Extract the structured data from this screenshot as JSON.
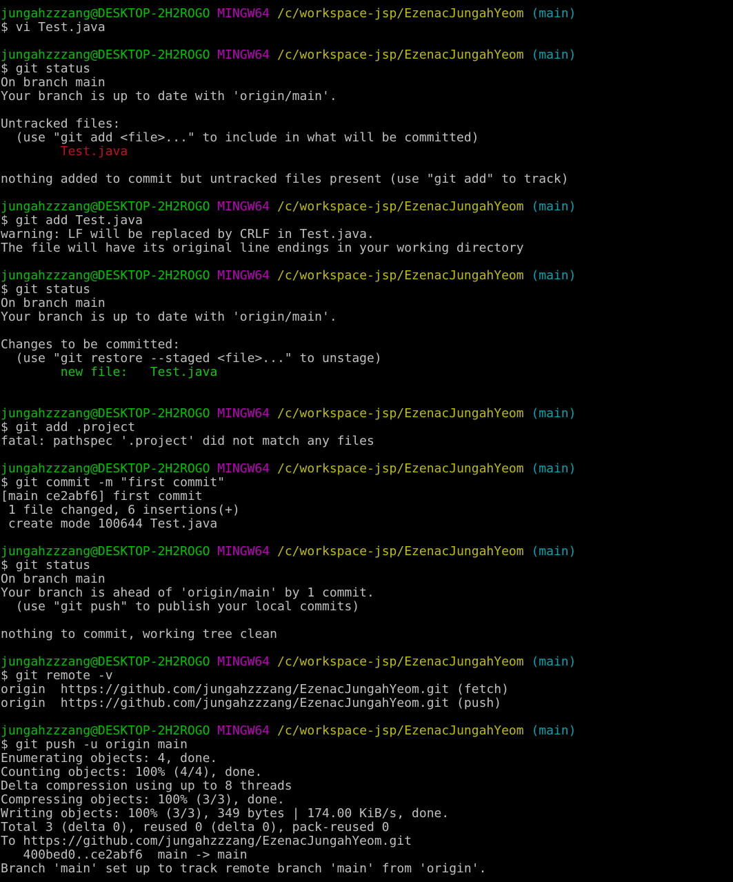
{
  "colors": {
    "background": "#000000",
    "default_text": "#c0c0c0",
    "user_host": "#00c400",
    "mingw": "#bf00bf",
    "path": "#bfbf00",
    "branch": "#00a6b2",
    "untracked": "#c50f1f",
    "staged": "#13c613"
  },
  "lines": [
    {
      "segs": [
        {
          "t": "jungahzzzang@DESKTOP-2H2ROGO",
          "c": "user"
        },
        {
          "t": " ",
          "c": "default"
        },
        {
          "t": "MINGW64",
          "c": "mingw"
        },
        {
          "t": " ",
          "c": "default"
        },
        {
          "t": "/c/workspace-jsp/EzenacJungahYeom",
          "c": "path"
        },
        {
          "t": " ",
          "c": "default"
        },
        {
          "t": "(main)",
          "c": "branch"
        }
      ]
    },
    {
      "segs": [
        {
          "t": "$ vi Test.java",
          "c": "default"
        }
      ]
    },
    {
      "segs": [
        {
          "t": "",
          "c": "default"
        }
      ]
    },
    {
      "segs": [
        {
          "t": "jungahzzzang@DESKTOP-2H2ROGO",
          "c": "user"
        },
        {
          "t": " ",
          "c": "default"
        },
        {
          "t": "MINGW64",
          "c": "mingw"
        },
        {
          "t": " ",
          "c": "default"
        },
        {
          "t": "/c/workspace-jsp/EzenacJungahYeom",
          "c": "path"
        },
        {
          "t": " ",
          "c": "default"
        },
        {
          "t": "(main)",
          "c": "branch"
        }
      ]
    },
    {
      "segs": [
        {
          "t": "$ git status",
          "c": "default"
        }
      ]
    },
    {
      "segs": [
        {
          "t": "On branch main",
          "c": "default"
        }
      ]
    },
    {
      "segs": [
        {
          "t": "Your branch is up to date with 'origin/main'.",
          "c": "default"
        }
      ]
    },
    {
      "segs": [
        {
          "t": "",
          "c": "default"
        }
      ]
    },
    {
      "segs": [
        {
          "t": "Untracked files:",
          "c": "default"
        }
      ]
    },
    {
      "segs": [
        {
          "t": "  (use \"git add <file>...\" to include in what will be committed)",
          "c": "default"
        }
      ]
    },
    {
      "segs": [
        {
          "t": "        ",
          "c": "default"
        },
        {
          "t": "Test.java",
          "c": "red"
        }
      ]
    },
    {
      "segs": [
        {
          "t": "",
          "c": "default"
        }
      ]
    },
    {
      "segs": [
        {
          "t": "nothing added to commit but untracked files present (use \"git add\" to track)",
          "c": "default"
        }
      ]
    },
    {
      "segs": [
        {
          "t": "",
          "c": "default"
        }
      ]
    },
    {
      "segs": [
        {
          "t": "jungahzzzang@DESKTOP-2H2ROGO",
          "c": "user"
        },
        {
          "t": " ",
          "c": "default"
        },
        {
          "t": "MINGW64",
          "c": "mingw"
        },
        {
          "t": " ",
          "c": "default"
        },
        {
          "t": "/c/workspace-jsp/EzenacJungahYeom",
          "c": "path"
        },
        {
          "t": " ",
          "c": "default"
        },
        {
          "t": "(main)",
          "c": "branch"
        }
      ]
    },
    {
      "segs": [
        {
          "t": "$ git add Test.java",
          "c": "default"
        }
      ]
    },
    {
      "segs": [
        {
          "t": "warning: LF will be replaced by CRLF in Test.java.",
          "c": "default"
        }
      ]
    },
    {
      "segs": [
        {
          "t": "The file will have its original line endings in your working directory",
          "c": "default"
        }
      ]
    },
    {
      "segs": [
        {
          "t": "",
          "c": "default"
        }
      ]
    },
    {
      "segs": [
        {
          "t": "jungahzzzang@DESKTOP-2H2ROGO",
          "c": "user"
        },
        {
          "t": " ",
          "c": "default"
        },
        {
          "t": "MINGW64",
          "c": "mingw"
        },
        {
          "t": " ",
          "c": "default"
        },
        {
          "t": "/c/workspace-jsp/EzenacJungahYeom",
          "c": "path"
        },
        {
          "t": " ",
          "c": "default"
        },
        {
          "t": "(main)",
          "c": "branch"
        }
      ]
    },
    {
      "segs": [
        {
          "t": "$ git status",
          "c": "default"
        }
      ]
    },
    {
      "segs": [
        {
          "t": "On branch main",
          "c": "default"
        }
      ]
    },
    {
      "segs": [
        {
          "t": "Your branch is up to date with 'origin/main'.",
          "c": "default"
        }
      ]
    },
    {
      "segs": [
        {
          "t": "",
          "c": "default"
        }
      ]
    },
    {
      "segs": [
        {
          "t": "Changes to be committed:",
          "c": "default"
        }
      ]
    },
    {
      "segs": [
        {
          "t": "  (use \"git restore --staged <file>...\" to unstage)",
          "c": "default"
        }
      ]
    },
    {
      "segs": [
        {
          "t": "        ",
          "c": "default"
        },
        {
          "t": "new file:   Test.java",
          "c": "green"
        }
      ]
    },
    {
      "segs": [
        {
          "t": "",
          "c": "default"
        }
      ]
    },
    {
      "segs": [
        {
          "t": "",
          "c": "default"
        }
      ]
    },
    {
      "segs": [
        {
          "t": "jungahzzzang@DESKTOP-2H2ROGO",
          "c": "user"
        },
        {
          "t": " ",
          "c": "default"
        },
        {
          "t": "MINGW64",
          "c": "mingw"
        },
        {
          "t": " ",
          "c": "default"
        },
        {
          "t": "/c/workspace-jsp/EzenacJungahYeom",
          "c": "path"
        },
        {
          "t": " ",
          "c": "default"
        },
        {
          "t": "(main)",
          "c": "branch"
        }
      ]
    },
    {
      "segs": [
        {
          "t": "$ git add .project",
          "c": "default"
        }
      ]
    },
    {
      "segs": [
        {
          "t": "fatal: pathspec '.project' did not match any files",
          "c": "default"
        }
      ]
    },
    {
      "segs": [
        {
          "t": "",
          "c": "default"
        }
      ]
    },
    {
      "segs": [
        {
          "t": "jungahzzzang@DESKTOP-2H2ROGO",
          "c": "user"
        },
        {
          "t": " ",
          "c": "default"
        },
        {
          "t": "MINGW64",
          "c": "mingw"
        },
        {
          "t": " ",
          "c": "default"
        },
        {
          "t": "/c/workspace-jsp/EzenacJungahYeom",
          "c": "path"
        },
        {
          "t": " ",
          "c": "default"
        },
        {
          "t": "(main)",
          "c": "branch"
        }
      ]
    },
    {
      "segs": [
        {
          "t": "$ git commit -m \"first commit\"",
          "c": "default"
        }
      ]
    },
    {
      "segs": [
        {
          "t": "[main ce2abf6] first commit",
          "c": "default"
        }
      ]
    },
    {
      "segs": [
        {
          "t": " 1 file changed, 6 insertions(+)",
          "c": "default"
        }
      ]
    },
    {
      "segs": [
        {
          "t": " create mode 100644 Test.java",
          "c": "default"
        }
      ]
    },
    {
      "segs": [
        {
          "t": "",
          "c": "default"
        }
      ]
    },
    {
      "segs": [
        {
          "t": "jungahzzzang@DESKTOP-2H2ROGO",
          "c": "user"
        },
        {
          "t": " ",
          "c": "default"
        },
        {
          "t": "MINGW64",
          "c": "mingw"
        },
        {
          "t": " ",
          "c": "default"
        },
        {
          "t": "/c/workspace-jsp/EzenacJungahYeom",
          "c": "path"
        },
        {
          "t": " ",
          "c": "default"
        },
        {
          "t": "(main)",
          "c": "branch"
        }
      ]
    },
    {
      "segs": [
        {
          "t": "$ git status",
          "c": "default"
        }
      ]
    },
    {
      "segs": [
        {
          "t": "On branch main",
          "c": "default"
        }
      ]
    },
    {
      "segs": [
        {
          "t": "Your branch is ahead of 'origin/main' by 1 commit.",
          "c": "default"
        }
      ]
    },
    {
      "segs": [
        {
          "t": "  (use \"git push\" to publish your local commits)",
          "c": "default"
        }
      ]
    },
    {
      "segs": [
        {
          "t": "",
          "c": "default"
        }
      ]
    },
    {
      "segs": [
        {
          "t": "nothing to commit, working tree clean",
          "c": "default"
        }
      ]
    },
    {
      "segs": [
        {
          "t": "",
          "c": "default"
        }
      ]
    },
    {
      "segs": [
        {
          "t": "jungahzzzang@DESKTOP-2H2ROGO",
          "c": "user"
        },
        {
          "t": " ",
          "c": "default"
        },
        {
          "t": "MINGW64",
          "c": "mingw"
        },
        {
          "t": " ",
          "c": "default"
        },
        {
          "t": "/c/workspace-jsp/EzenacJungahYeom",
          "c": "path"
        },
        {
          "t": " ",
          "c": "default"
        },
        {
          "t": "(main)",
          "c": "branch"
        }
      ]
    },
    {
      "segs": [
        {
          "t": "$ git remote -v",
          "c": "default"
        }
      ]
    },
    {
      "segs": [
        {
          "t": "origin  https://github.com/jungahzzzang/EzenacJungahYeom.git (fetch)",
          "c": "default"
        }
      ]
    },
    {
      "segs": [
        {
          "t": "origin  https://github.com/jungahzzzang/EzenacJungahYeom.git (push)",
          "c": "default"
        }
      ]
    },
    {
      "segs": [
        {
          "t": "",
          "c": "default"
        }
      ]
    },
    {
      "segs": [
        {
          "t": "jungahzzzang@DESKTOP-2H2ROGO",
          "c": "user"
        },
        {
          "t": " ",
          "c": "default"
        },
        {
          "t": "MINGW64",
          "c": "mingw"
        },
        {
          "t": " ",
          "c": "default"
        },
        {
          "t": "/c/workspace-jsp/EzenacJungahYeom",
          "c": "path"
        },
        {
          "t": " ",
          "c": "default"
        },
        {
          "t": "(main)",
          "c": "branch"
        }
      ]
    },
    {
      "segs": [
        {
          "t": "$ git push -u origin main",
          "c": "default"
        }
      ]
    },
    {
      "segs": [
        {
          "t": "Enumerating objects: 4, done.",
          "c": "default"
        }
      ]
    },
    {
      "segs": [
        {
          "t": "Counting objects: 100% (4/4), done.",
          "c": "default"
        }
      ]
    },
    {
      "segs": [
        {
          "t": "Delta compression using up to 8 threads",
          "c": "default"
        }
      ]
    },
    {
      "segs": [
        {
          "t": "Compressing objects: 100% (3/3), done.",
          "c": "default"
        }
      ]
    },
    {
      "segs": [
        {
          "t": "Writing objects: 100% (3/3), 349 bytes | 174.00 KiB/s, done.",
          "c": "default"
        }
      ]
    },
    {
      "segs": [
        {
          "t": "Total 3 (delta 0), reused 0 (delta 0), pack-reused 0",
          "c": "default"
        }
      ]
    },
    {
      "segs": [
        {
          "t": "To https://github.com/jungahzzzang/EzenacJungahYeom.git",
          "c": "default"
        }
      ]
    },
    {
      "segs": [
        {
          "t": "   400bed0..ce2abf6  main -> main",
          "c": "default"
        }
      ]
    },
    {
      "segs": [
        {
          "t": "Branch 'main' set up to track remote branch 'main' from 'origin'.",
          "c": "default"
        }
      ]
    }
  ]
}
